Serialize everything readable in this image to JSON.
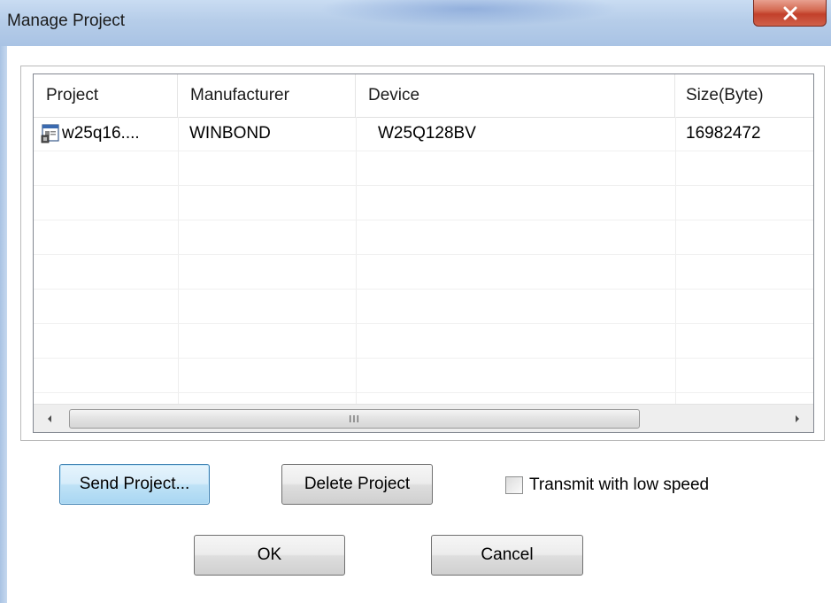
{
  "window": {
    "title": "Manage Project",
    "close_glyph": "X"
  },
  "list": {
    "columns": [
      "Project",
      "Manufacturer",
      "Device",
      "Size(Byte)"
    ],
    "rows": [
      {
        "project": "w25q16....",
        "manufacturer": "WINBOND",
        "device": "W25Q128BV",
        "size": "16982472"
      }
    ],
    "scroll_grip": "III"
  },
  "buttons": {
    "send_project": "Send Project...",
    "delete_project": "Delete Project",
    "ok": "OK",
    "cancel": "Cancel"
  },
  "options": {
    "transmit_low_speed_label": "Transmit with low speed",
    "transmit_low_speed_checked": false
  },
  "colors": {
    "titlebar": "#b6cde9",
    "close_button": "#c2402b",
    "default_button_border": "#3c7fb1"
  }
}
